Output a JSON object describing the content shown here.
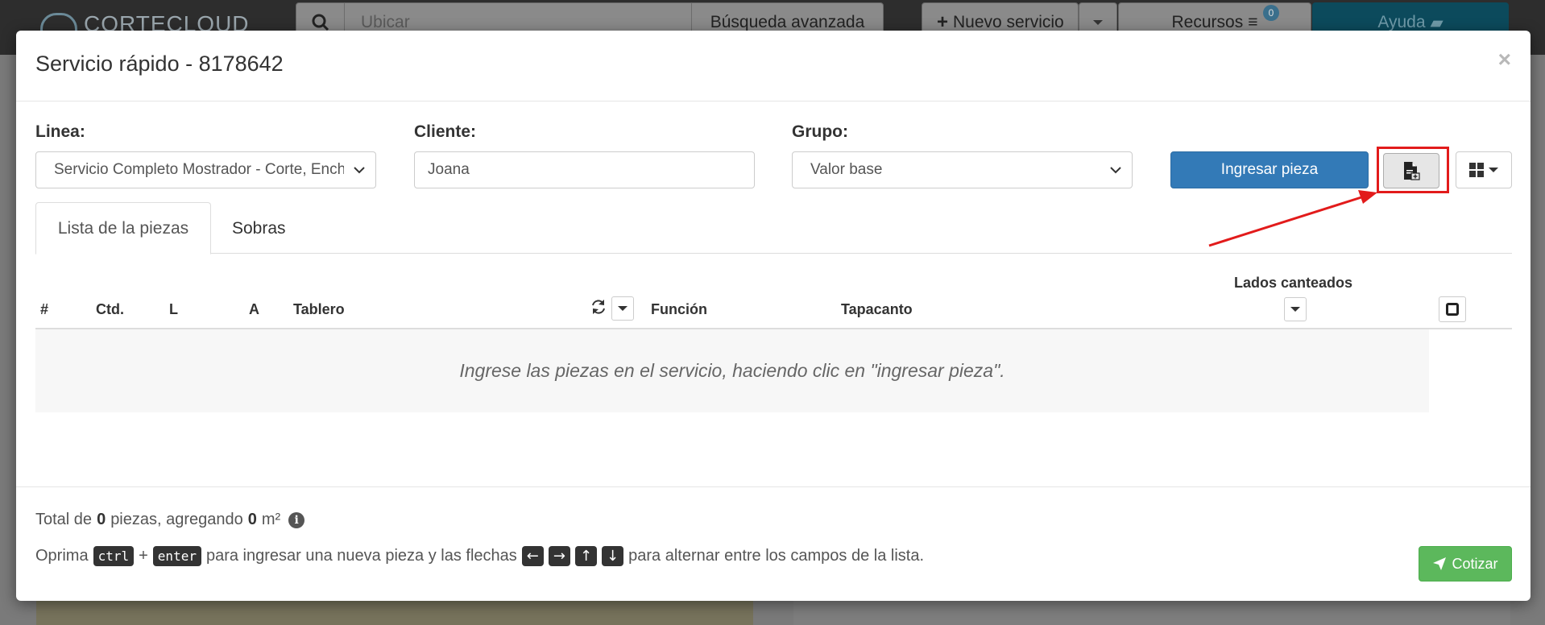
{
  "background": {
    "logo_text": "CORTECLOUD",
    "search_placeholder": "Ubicar",
    "advanced_search": "Búsqueda avanzada",
    "new_service": "Nuevo servicio",
    "resources": "Recursos",
    "resources_badge": "0",
    "help": "Ayuda"
  },
  "modal": {
    "title": "Servicio rápido - 8178642",
    "close": "×",
    "fields": {
      "linea_label": "Linea:",
      "linea_value": "Servicio Completo Mostrador - Corte, Ench",
      "cliente_label": "Cliente:",
      "cliente_value": "Joana",
      "grupo_label": "Grupo:",
      "grupo_value": "Valor base"
    },
    "add_piece_button": "Ingresar pieza",
    "tabs": [
      {
        "label": "Lista de la piezas",
        "active": true
      },
      {
        "label": "Sobras",
        "active": false
      }
    ],
    "table": {
      "columns": {
        "num": "#",
        "ctd": "Ctd.",
        "l": "L",
        "a": "A",
        "tablero": "Tablero",
        "funcion": "Función",
        "tapacanto": "Tapacanto",
        "lados": "Lados canteados"
      },
      "empty_message": "Ingrese las piezas en el servicio, haciendo clic en \"ingresar pieza\"."
    },
    "footer": {
      "total_prefix": "Total de",
      "total_pieces": "0",
      "total_mid": "piezas, agregando",
      "total_area": "0",
      "total_unit": "m²",
      "hint_prefix": "Oprima",
      "key_ctrl": "ctrl",
      "plus": "+",
      "key_enter": "enter",
      "hint_mid": "para ingresar una nueva pieza y las flechas",
      "hint_suffix": "para alternar entre los campos de la lista.",
      "quote_button": "Cotizar"
    }
  },
  "colors": {
    "primary": "#337ab7",
    "success": "#5cb85c",
    "highlight": "#e21b1b"
  }
}
